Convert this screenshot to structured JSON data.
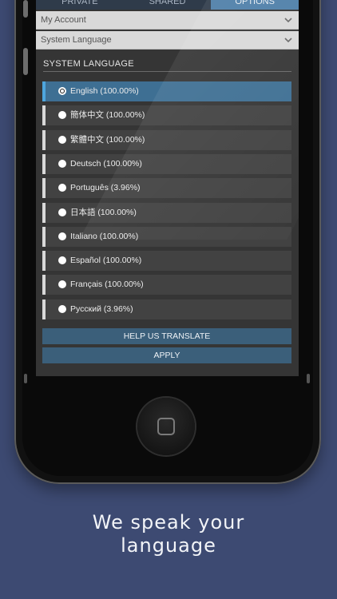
{
  "tabs": [
    {
      "label": "PRIVATE"
    },
    {
      "label": "SHARED"
    },
    {
      "label": "OPTIONS"
    }
  ],
  "dropdowns": {
    "account": "My Account",
    "system_language": "System Language"
  },
  "section_title": "SYSTEM LANGUAGE",
  "languages": [
    {
      "label": "English (100.00%)",
      "selected": true
    },
    {
      "label": "簡体中文 (100.00%)"
    },
    {
      "label": "繁體中文 (100.00%)"
    },
    {
      "label": "Deutsch (100.00%)"
    },
    {
      "label": "Português (3.96%)"
    },
    {
      "label": "日本語 (100.00%)"
    },
    {
      "label": "Italiano (100.00%)"
    },
    {
      "label": "Español (100.00%)"
    },
    {
      "label": "Français (100.00%)"
    },
    {
      "label": "Русский (3.96%)"
    }
  ],
  "buttons": {
    "help_translate": "HELP US TRANSLATE",
    "apply": "APPLY"
  },
  "caption": {
    "line1": "We speak your",
    "line2": "language"
  },
  "colors": {
    "background": "#3d4a72",
    "accent": "#3e6f93",
    "button": "#3b5f7a"
  },
  "icons": {
    "dropdown": "chevron-down-icon",
    "radio": "radio-icon",
    "home": "home-button"
  }
}
